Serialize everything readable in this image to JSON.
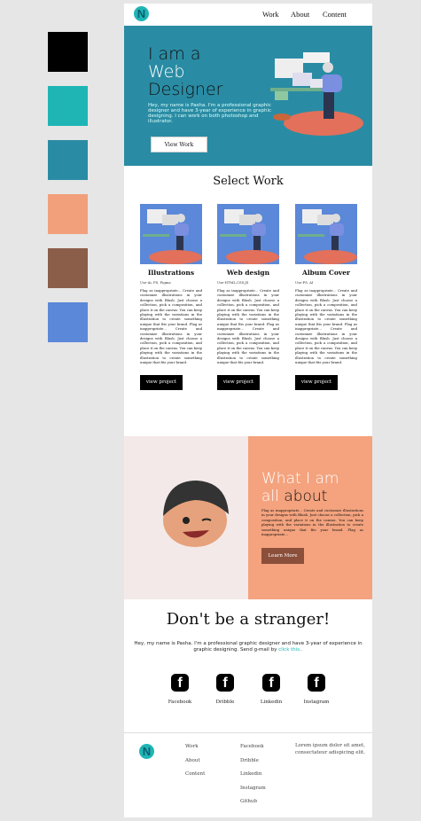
{
  "swatches": [
    "#000000",
    "#1fb5b5",
    "#2a8ca4",
    "#f2a07b",
    "#8b5e4a",
    "#5b88d8"
  ],
  "nav": {
    "logo": "N",
    "links": [
      "Work",
      "About",
      "Content"
    ]
  },
  "hero": {
    "line1": "I am a",
    "line2": "Web",
    "line3": "Designer",
    "text": "Hey, my name is Pasha. I'm a professional graphic designer and have 3-year of experience in graphic designing. I can work on both photoshop and illustrator.",
    "button": "View Work"
  },
  "work": {
    "title": "Select Work",
    "cards": [
      {
        "title": "Illustrations",
        "sub": "Use-Ai, PS, Figma",
        "body": "Flag as inappropriate... Create and customize illustrations in your designs with Blush. Just choose a collection, pick a composition, and place it on the canvas. You can keep playing with the variations in the illustration to create something unique that fits your brand. Flag as inappropriate... Create and customize illustrations in your designs with Blush. Just choose a collection, pick a composition, and place it on the canvas. You can keep playing with the variations in the illustration to create something unique that fits your brand.",
        "button": "view project"
      },
      {
        "title": "Web design",
        "sub": "Use-HTML,CSS,JS",
        "body": "Flag as inappropriate... Create and customize illustrations in your designs with Blush. Just choose a collection, pick a composition, and place it on the canvas. You can keep playing with the variations in the illustration to create something unique that fits your brand. Flag as inappropriate... Create and customize illustrations in your designs with Blush. Just choose a collection, pick a composition, and place it on the canvas. You can keep playing with the variations in the illustration to create something unique that fits your brand.",
        "button": "view project"
      },
      {
        "title": "Album Cover",
        "sub": "Use-PS, AI",
        "body": "Flag as inappropriate... Create and customize illustrations in your designs with Blush. Just choose a collection, pick a composition, and place it on the canvas. You can keep playing with the variations in the illustration to create something unique that fits your brand. Flag as inappropriate... Create and customize illustrations in your designs with Blush. Just choose a collection, pick a composition, and place it on the canvas. You can keep playing with the variations in the illustration to create something unique that fits your brand.",
        "button": "view project"
      }
    ]
  },
  "about": {
    "title1": "What I am",
    "title2": "all",
    "title3": "about",
    "text": "Flag as inappropriate... Create and customize illustrations in your designs with Blush. Just choose a collection, pick a composition, and place it on the canvas. You can keep playing with the variations in the illustration to create something unique that fits your brand. Flag as inappropriate...",
    "button": "Learn More"
  },
  "contact": {
    "title": "Don't be a stranger!",
    "text": "Hey, my name is Pasha. I'm a professional graphic designer and have 3-year of experience in graphic designing.  Send g-mail by",
    "link": "click this..",
    "socials": [
      "Facebook",
      "Dribble",
      "Linkedin",
      "Instagram"
    ],
    "icon": "f"
  },
  "footer": {
    "nav": [
      "Work",
      "About",
      "Content"
    ],
    "social": [
      "Facebook",
      "Dribble",
      "Linkedin",
      "Instagram",
      "Github"
    ],
    "text": "Lorem ipsum dolor sit amet, consectateur adispicing elit."
  }
}
